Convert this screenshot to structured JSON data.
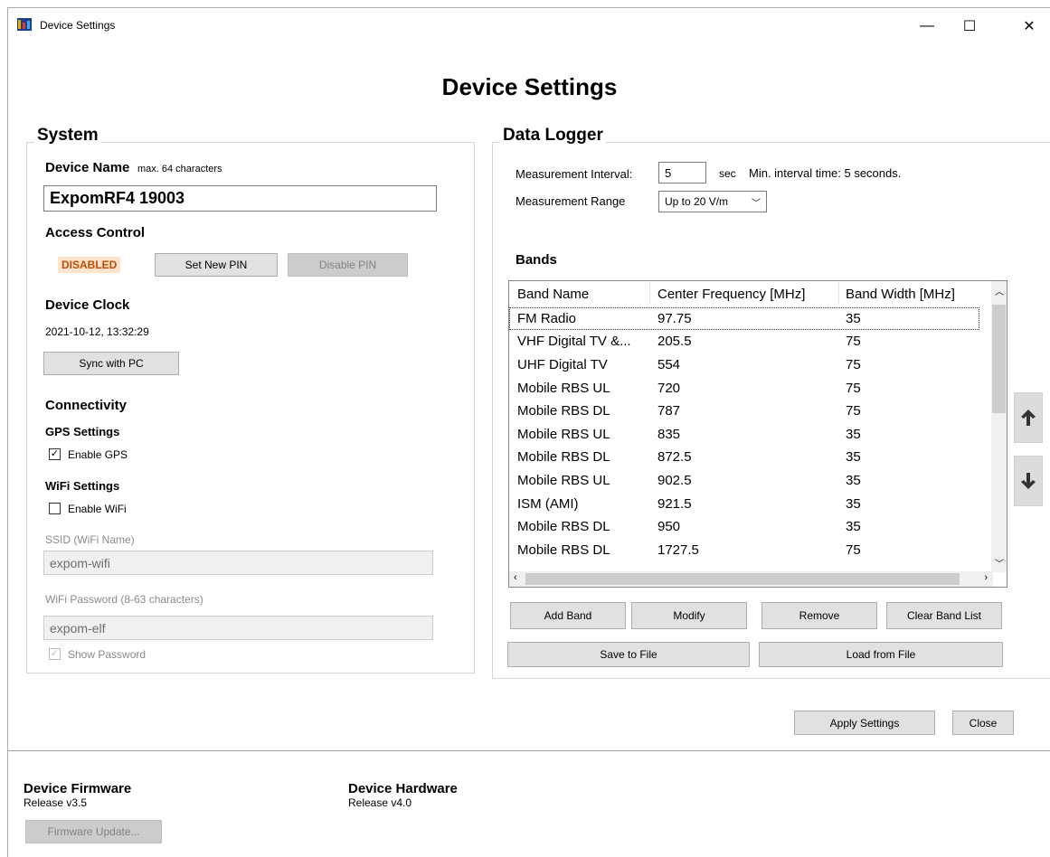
{
  "window": {
    "title": "Device Settings",
    "controls": {
      "minimize": "—",
      "maximize": "☐",
      "close": "✕"
    }
  },
  "page_title": "Device Settings",
  "system": {
    "legend": "System",
    "device_name": {
      "label": "Device Name",
      "hint": "max. 64 characters",
      "value": "ExpomRF4 19003"
    },
    "access_control": {
      "label": "Access Control",
      "status": "DISABLED",
      "set_pin": "Set New PIN",
      "disable_pin": "Disable PIN"
    },
    "device_clock": {
      "label": "Device Clock",
      "value": "2021-10-12, 13:32:29",
      "sync_button": "Sync with PC"
    },
    "connectivity": {
      "label": "Connectivity",
      "gps": {
        "label": "GPS Settings",
        "enable_label": "Enable GPS",
        "checked": true
      },
      "wifi": {
        "label": "WiFi Settings",
        "enable_label": "Enable WiFi",
        "checked": false,
        "ssid_label": "SSID (WiFi Name)",
        "ssid_value": "expom-wifi",
        "password_label": "WiFi Password (8-63 characters)",
        "password_value": "expom-elf",
        "show_password_label": "Show Password",
        "show_password_checked": true
      }
    }
  },
  "data_logger": {
    "legend": "Data Logger",
    "interval": {
      "label": "Measurement Interval:",
      "value": "5",
      "unit": "sec",
      "note": "Min. interval time: 5 seconds."
    },
    "range": {
      "label": "Measurement Range",
      "selected": "Up to 20 V/m"
    },
    "bands": {
      "label": "Bands",
      "columns": [
        "Band Name",
        "Center Frequency [MHz]",
        "Band Width [MHz]"
      ],
      "rows": [
        [
          "FM Radio",
          "97.75",
          "35"
        ],
        [
          "VHF Digital TV &...",
          "205.5",
          "75"
        ],
        [
          "UHF Digital TV",
          "554",
          "75"
        ],
        [
          "Mobile RBS UL",
          "720",
          "75"
        ],
        [
          "Mobile RBS DL",
          "787",
          "75"
        ],
        [
          "Mobile RBS UL",
          "835",
          "35"
        ],
        [
          "Mobile RBS DL",
          "872.5",
          "35"
        ],
        [
          "Mobile RBS UL",
          "902.5",
          "35"
        ],
        [
          "ISM (AMI)",
          "921.5",
          "35"
        ],
        [
          "Mobile RBS DL",
          "950",
          "35"
        ],
        [
          "Mobile RBS DL",
          "1727.5",
          "75"
        ]
      ],
      "buttons": {
        "add": "Add Band",
        "modify": "Modify",
        "remove": "Remove",
        "clear": "Clear Band List",
        "save": "Save to File",
        "load": "Load from File"
      }
    }
  },
  "footer_buttons": {
    "apply": "Apply Settings",
    "close": "Close"
  },
  "firmware": {
    "label": "Device Firmware",
    "value": "Release v3.5",
    "update_button": "Firmware Update..."
  },
  "hardware": {
    "label": "Device Hardware",
    "value": "Release v4.0"
  }
}
